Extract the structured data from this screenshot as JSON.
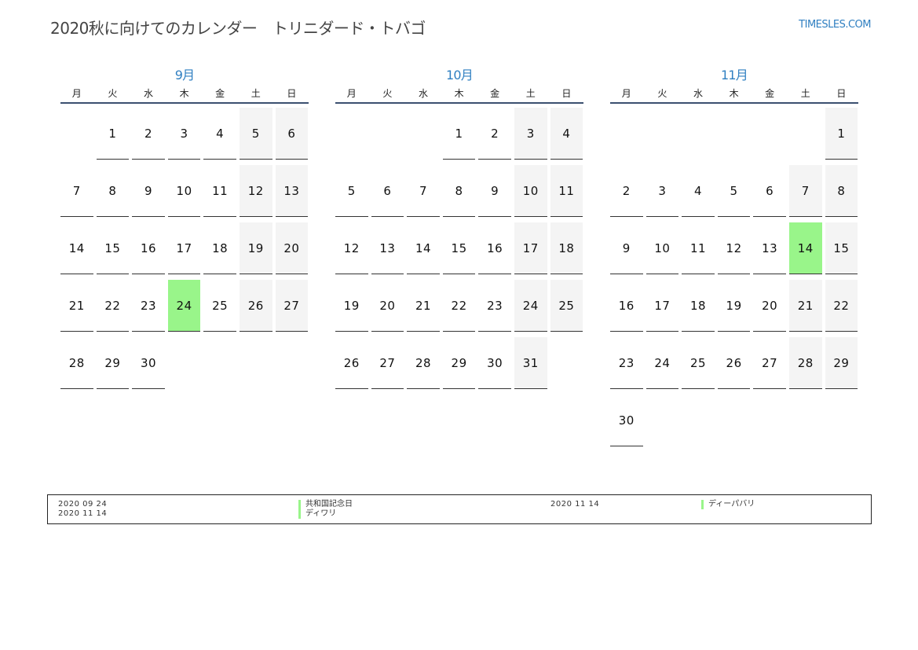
{
  "header": {
    "title": "2020秋に向けてのカレンダー　トリニダード・トバゴ",
    "site": "TIMESLES.COM"
  },
  "weekdays": [
    "月",
    "火",
    "水",
    "木",
    "金",
    "土",
    "日"
  ],
  "months": [
    {
      "title": "9月",
      "offset": 1,
      "days": 30,
      "holidays": [
        24
      ]
    },
    {
      "title": "10月",
      "offset": 3,
      "days": 31,
      "holidays": []
    },
    {
      "title": "11月",
      "offset": 6,
      "days": 30,
      "holidays": [
        14
      ]
    }
  ],
  "legend": [
    {
      "date": "2020 09 24",
      "name": "共和国記念日"
    },
    {
      "date": "2020 11 14",
      "name": "ディワリ"
    },
    {
      "date": "2020 11 14",
      "name": "ディーパバリ"
    }
  ],
  "colors": {
    "accent": "#2f7fc1",
    "holiday": "#99f58a",
    "weekend": "#f4f4f4",
    "rule": "#3b5070"
  }
}
